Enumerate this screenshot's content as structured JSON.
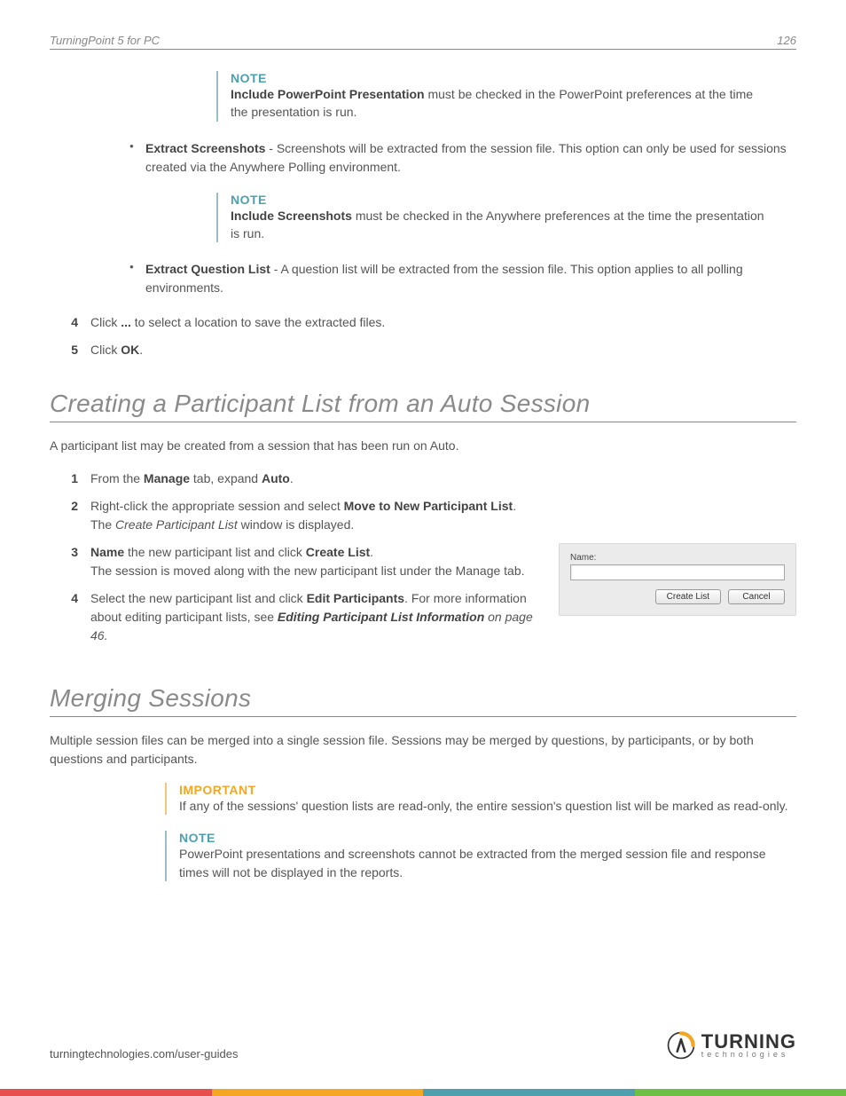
{
  "header": {
    "title_left": "TurningPoint 5 for PC",
    "page_number": "126"
  },
  "note1": {
    "label": "NOTE",
    "bold": "Include PowerPoint Presentation",
    "rest": " must be checked in the PowerPoint preferences at the time the presentation is run."
  },
  "bullet_screenshots": {
    "bold": "Extract Screenshots",
    "rest": " - Screenshots will be extracted from the session file. This option can only be used for sessions created via the Anywhere Polling environment."
  },
  "note2": {
    "label": "NOTE",
    "bold": "Include Screenshots",
    "rest": " must be checked in the Anywhere preferences at the time the presentation is run."
  },
  "bullet_qlist": {
    "bold": "Extract Question List",
    "rest": " - A question list will be extracted from the session file. This option applies to all polling environments."
  },
  "stepsA": {
    "s4": {
      "num": "4",
      "pre": "Click ",
      "bold": "...",
      "post": " to select a location to save the extracted files."
    },
    "s5": {
      "num": "5",
      "pre": "Click ",
      "bold": "OK",
      "post": "."
    }
  },
  "section1": {
    "heading": "Creating a Participant List from an Auto Session",
    "intro": "A participant list may be created from a session that has been run on Auto."
  },
  "stepsB": {
    "s1": {
      "num": "1",
      "pre": "From the ",
      "b1": "Manage",
      "mid": " tab, expand ",
      "b2": "Auto",
      "post": "."
    },
    "s2": {
      "num": "2",
      "pre": "Right-click the appropriate session and select ",
      "b1": "Move to New Participant List",
      "post": ".",
      "line2_pre": "The ",
      "line2_i": "Create Participant List",
      "line2_post": " window is displayed."
    },
    "s3": {
      "num": "3",
      "b1": "Name",
      "mid": " the new participant list and click ",
      "b2": "Create List",
      "post": ".",
      "line2": "The session is moved along with the new participant list under the Manage tab."
    },
    "s4": {
      "num": "4",
      "pre": "Select the new participant list and click ",
      "b1": "Edit Participants",
      "post": ". For more information about editing participant lists, see ",
      "xref": "Editing Participant List Information",
      "xref_tail": " on page 46."
    }
  },
  "dialog": {
    "name_label": "Name:",
    "create": "Create List",
    "cancel": "Cancel"
  },
  "section2": {
    "heading": "Merging Sessions",
    "intro": "Multiple session files can be merged into a single session file. Sessions may be merged by questions, by participants, or by both questions and participants."
  },
  "important": {
    "label": "IMPORTANT",
    "text": "If any of the sessions' question lists are read-only, the entire session's question list will be marked as read-only."
  },
  "note3": {
    "label": "NOTE",
    "text": "PowerPoint presentations and screenshots cannot be extracted from the merged session file and response times will not be displayed in the reports."
  },
  "footer": {
    "url": "turningtechnologies.com/user-guides",
    "logo_main": "TURNING",
    "logo_sub": "technologies"
  }
}
